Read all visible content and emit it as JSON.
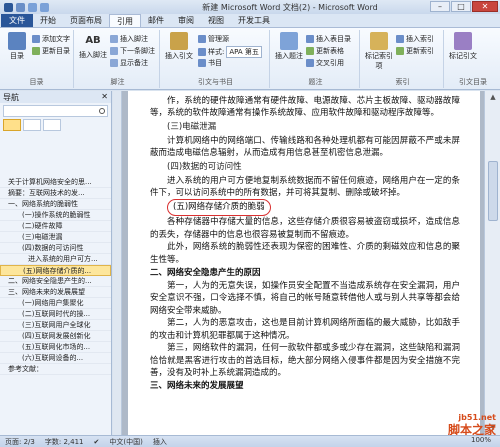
{
  "window": {
    "title": "新建 Microsoft Word 文档(2) - Microsoft Word",
    "min": "–",
    "max": "□",
    "close": "✕"
  },
  "tabs": [
    "文件",
    "开始",
    "页面布局",
    "引用",
    "邮件",
    "审阅",
    "视图",
    "开发工具"
  ],
  "ribbon": {
    "toc_btn": "目录",
    "add_text": "添加文字",
    "update_toc": "更新目录",
    "group_toc": "目录",
    "insert_footnote": "插入脚注",
    "ab_icon": "AB",
    "next_footnote": "下一条脚注",
    "show_notes": "显示备注",
    "group_footnote": "脚注",
    "insert_citation": "插入引文",
    "manage_sources": "管理源",
    "style_label": "样式:",
    "style_value": "APA 第五",
    "bibliography": "书目",
    "group_citation": "引文与书目",
    "insert_caption": "插入题注",
    "insert_toc_figures": "插入表目录",
    "update_table": "更新表格",
    "cross_ref": "交叉引用",
    "group_caption": "题注",
    "mark_entry": "标记索引项",
    "insert_index": "插入索引",
    "update_index": "更新索引",
    "group_index": "索引",
    "mark_citation": "标记引文",
    "group_toa": "引文目录"
  },
  "nav": {
    "title": "导航",
    "close": "✕",
    "items": [
      {
        "text": "关于计算机网络安全的思...",
        "level": "l1",
        "sel": false
      },
      {
        "text": "摘要：互联网技术的发...",
        "level": "l1",
        "sel": false
      },
      {
        "text": "一、网络系统的脆弱性",
        "level": "l1",
        "sel": false
      },
      {
        "text": "(一)操作系统的脆弱性",
        "level": "l2",
        "sel": false
      },
      {
        "text": "(二)硬件故障",
        "level": "l2",
        "sel": false
      },
      {
        "text": "(三)电磁泄漏",
        "level": "l2",
        "sel": false
      },
      {
        "text": "(四)数据的可访问性",
        "level": "l2",
        "sel": false
      },
      {
        "text": "进入系统的用户可方...",
        "level": "l3",
        "sel": false
      },
      {
        "text": "(五)网络存储介质的...",
        "level": "l2",
        "sel": true
      },
      {
        "text": "二、网络安全隐患产生的...",
        "level": "l1",
        "sel": false
      },
      {
        "text": "三、网络未来的发展展望",
        "level": "l1",
        "sel": false
      },
      {
        "text": "(一)网络用户集聚化",
        "level": "l2",
        "sel": false
      },
      {
        "text": "(二)互联网时代的操...",
        "level": "l2",
        "sel": false
      },
      {
        "text": "(三)互联网用户全球化",
        "level": "l2",
        "sel": false
      },
      {
        "text": "(四)互联网发展创新化",
        "level": "l2",
        "sel": false
      },
      {
        "text": "(五)互联网化市场的...",
        "level": "l2",
        "sel": false
      },
      {
        "text": "(六)互联网设备的...",
        "level": "l2",
        "sel": false
      },
      {
        "text": "参考文献：",
        "level": "l1",
        "sel": false
      }
    ]
  },
  "doc": {
    "p1": "作，系统的硬件故障通常有硬件故障、电源故障、芯片主板故障、驱动器故障等，系统的软件故障通常有操作系统故障、应用软件故障和驱动程序故障等。",
    "h3": "(三)电磁泄漏",
    "p2": "计算机网络中的网络端口、传输线路和各种处理机都有可能因屏蔽不严或未屏蔽而造成电磁信息辐射，从而造成有用信息甚至机密信息泄漏。",
    "h4": "(四)数据的可访问性",
    "p3": "进入系统的用户可方便地复制系统数据而不留任何痕迹，网络用户在一定的条件下，可以访问系统中的所有数据，并可将其复制、删除或破坏掉。",
    "h5": "(五)网络存储介质的脆弱",
    "p4": "各种存储器中存储大量的信息，这些存储介质很容易被盗窃或损坏，造成信息的丢失，存储器中的信息也很容易被复制而不留痕迹。",
    "p5": "此外，网络系统的脆弱性还表现为保密的困难性、介质的剩磁效应和信息的聚生性等。",
    "h_sec2": "二、网络安全隐患产生的原因",
    "p6": "第一，人为的无意失误，如操作员安全配置不当造成系统存在安全漏洞，用户安全意识不强，口令选择不慎，将自己的帐号随意转借他人或与别人共享等都会给网络安全带来威胁。",
    "p7": "第二，人为的恶意攻击，这也是目前计算机网络所面临的最大威胁，比如敌手的攻击和计算机犯罪都属于这种情况。",
    "p8": "第三，网络软件的漏洞，任何一款软件都或多或少存在漏洞，这些缺陷和漏洞恰恰就是黑客进行攻击的首选目标，绝大部分网络入侵事件都是因为安全措施不完善，没有及时补上系统漏洞造成的。",
    "h_sec3": "三、网络未来的发展展望"
  },
  "status": {
    "page": "页面: 2/3",
    "words": "字数: 2,411",
    "lang": "中文(中国)",
    "mode": "插入",
    "zoom": "100%"
  },
  "watermark": {
    "line1": "jb51.net",
    "line2": "脚本之家"
  },
  "colors": {
    "file_tab": "#2a5699",
    "circle": "#d93030",
    "watermark": "#d64c1c"
  }
}
